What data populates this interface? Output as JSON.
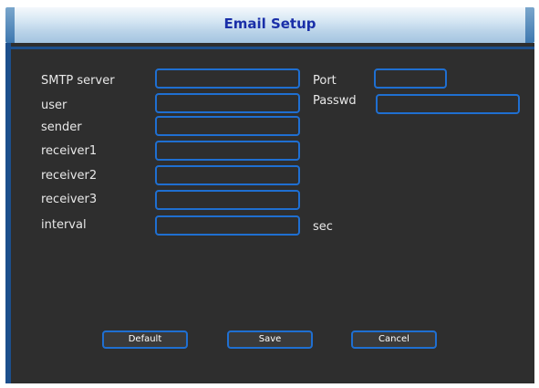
{
  "window": {
    "title": "Email Setup"
  },
  "form": {
    "smtp_server": {
      "label": "SMTP server",
      "value": ""
    },
    "port": {
      "label": "Port",
      "value": ""
    },
    "user": {
      "label": "user",
      "value": ""
    },
    "passwd": {
      "label": "Passwd",
      "value": ""
    },
    "sender": {
      "label": "sender",
      "value": ""
    },
    "receiver1": {
      "label": "receiver1",
      "value": ""
    },
    "receiver2": {
      "label": "receiver2",
      "value": ""
    },
    "receiver3": {
      "label": "receiver3",
      "value": ""
    },
    "interval": {
      "label": "interval",
      "value": "",
      "unit": "sec"
    }
  },
  "buttons": {
    "default_label": "Default",
    "save_label": "Save",
    "cancel_label": "Cancel"
  },
  "colors": {
    "accent": "#1f6fd1",
    "panel_bg": "#2e2e2e",
    "title_text": "#1a2fa8",
    "label_text": "#e8e8e8"
  }
}
